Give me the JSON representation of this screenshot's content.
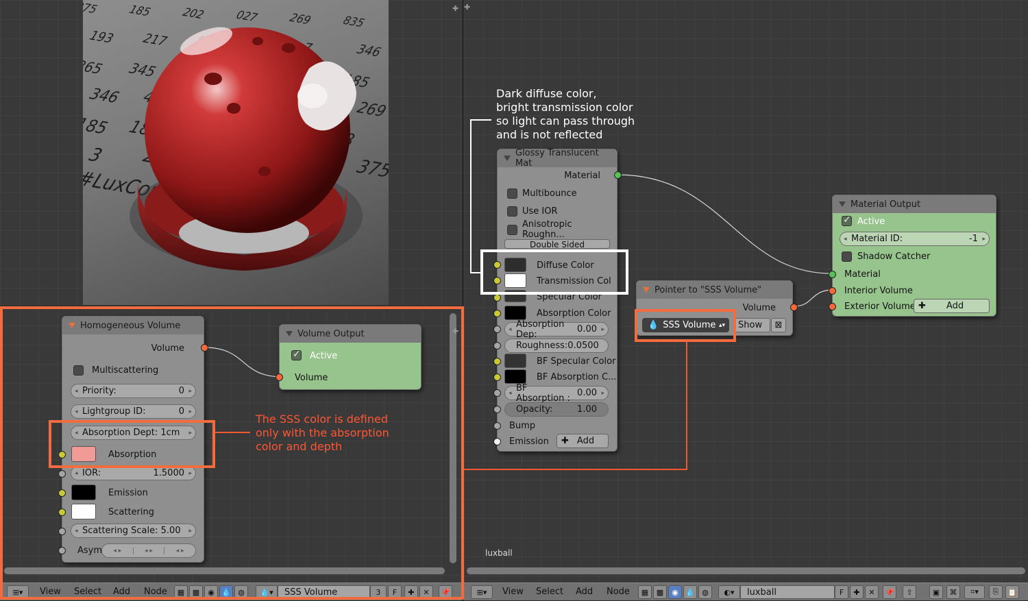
{
  "render": {
    "numbers": [
      "375",
      "185",
      "202",
      "027",
      "269",
      "835",
      "193",
      "217",
      "957",
      "185",
      "7",
      "346",
      "865",
      "345",
      "19",
      "185",
      "02",
      "185",
      "346",
      "492",
      "35",
      "357",
      "15",
      "269",
      "185",
      "184",
      "86",
      "455",
      "375",
      "8",
      "3",
      "269",
      "92",
      "21",
      "027",
      "375",
      "#LuxCore"
    ]
  },
  "left_editor": {
    "homogeneous_node": {
      "title": "Homogeneous Volume",
      "output_label": "Volume",
      "multiscattering_label": "Multiscattering",
      "priority": {
        "label": "Priority:",
        "value": "0"
      },
      "lightgroup": {
        "label": "Lightgroup ID:",
        "value": "0"
      },
      "absorption_depth": {
        "label": "Absorption Dept:",
        "value": "1cm"
      },
      "absorption_label": "Absorption",
      "ior": {
        "label": "IOR:",
        "value": "1.5000"
      },
      "emission_label": "Emission",
      "scattering_label": "Scattering",
      "scattering_scale": {
        "label": "Scattering Scale:",
        "value": "5.00"
      },
      "asym_label": "Asym"
    },
    "volume_output_node": {
      "title": "Volume Output",
      "active_label": "Active",
      "volume_label": "Volume"
    },
    "annotation": "The SSS color is defined\nonly with the absorption\ncolor and depth",
    "toolbar": {
      "view": "View",
      "select": "Select",
      "add": "Add",
      "node": "Node",
      "datablock_name": "SSS Volume",
      "users": "3",
      "fake_user": "F"
    }
  },
  "right_editor": {
    "annotation": "Dark diffuse color,\nbright transmission color\nso light can pass through\nand is not reflected",
    "glossy_node": {
      "title": "Glossy Translucent Mat",
      "output_label": "Material",
      "multibounce_label": "Multibounce",
      "use_ior_label": "Use IOR",
      "anisotropic_label": "Anisotropic Roughn...",
      "double_sided_label": "Double Sided",
      "diffuse_label": "Diffuse Color",
      "transmission_label": "Transmission Col",
      "specular_label": "Specular Color",
      "absorption_color_label": "Absorption Color",
      "absorption_depth": {
        "label": "Absorption Dep:",
        "value": "0.00"
      },
      "roughness": {
        "label": "Roughness:",
        "value": "0.0500"
      },
      "bf_specular_label": "BF Specular Color",
      "bf_absorption_color_label": "BF Absorption C...",
      "bf_absorption_depth": {
        "label": "BF Absorption :",
        "value": "0.00"
      },
      "opacity": {
        "label": "Opacity:",
        "value": "1.00"
      },
      "bump_label": "Bump",
      "emission_label": "Emission",
      "add_label": "Add"
    },
    "pointer_node": {
      "title": "Pointer to \"SSS Volume\"",
      "output_label": "Volume",
      "selector_value": "SSS Volume",
      "show_label": "Show"
    },
    "material_output_node": {
      "title": "Material Output",
      "active_label": "Active",
      "material_id": {
        "label": "Material ID:",
        "value": "-1"
      },
      "shadow_catcher_label": "Shadow Catcher",
      "material_label": "Material",
      "interior_label": "Interior Volume",
      "exterior_label": "Exterior Volume",
      "add_label": "Add"
    },
    "material_name_label": "luxball",
    "toolbar": {
      "view": "View",
      "select": "Select",
      "add": "Add",
      "node": "Node",
      "datablock_name": "luxball",
      "fake_user": "F"
    }
  },
  "colors": {
    "highlight_orange": "#f26c3f",
    "highlight_white": "#ffffff",
    "annotation_red": "#ff5533",
    "socket_orange": "#f26a3a",
    "socket_green": "#56c156",
    "socket_yellow": "#c9c936",
    "node_green_panel": "#97c38c",
    "absorption_swatch": "#f29a96"
  }
}
